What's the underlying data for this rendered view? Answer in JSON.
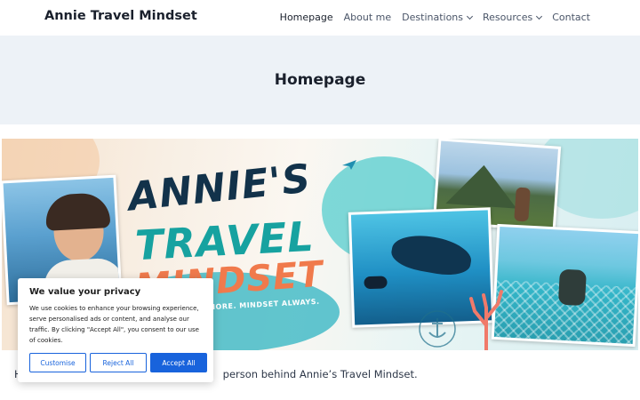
{
  "header": {
    "site_title": "Annie Travel Mindset",
    "nav": [
      {
        "label": "Homepage",
        "active": true
      },
      {
        "label": "About me"
      },
      {
        "label": "Destinations",
        "has_dropdown": true
      },
      {
        "label": "Resources",
        "has_dropdown": true
      },
      {
        "label": "Contact"
      }
    ]
  },
  "page": {
    "title": "Homepage",
    "intro_left": "H",
    "intro_right": "person behind Annie’s Travel Mindset."
  },
  "banner": {
    "logo_line1": "ANNIE'S",
    "logo_line2": "TRAVEL",
    "logo_line3": "MINDSET",
    "tagline": "MORE. MINDSET ALWAYS."
  },
  "cookie": {
    "title": "We value your privacy",
    "body_lines": [
      "We use cookies to enhance your browsing experience,",
      "serve personalised ads or content, and analyse our",
      "traffic. By clicking \"Accept All\", you consent to our use",
      "of cookies."
    ],
    "customise": "Customise",
    "reject": "Reject All",
    "accept": "Accept All"
  },
  "colors": {
    "accent": "#1863dc",
    "title_band": "#edf2f7",
    "logo_navy": "#12324a",
    "logo_teal": "#17a2a0",
    "logo_coral": "#f07a4c"
  }
}
